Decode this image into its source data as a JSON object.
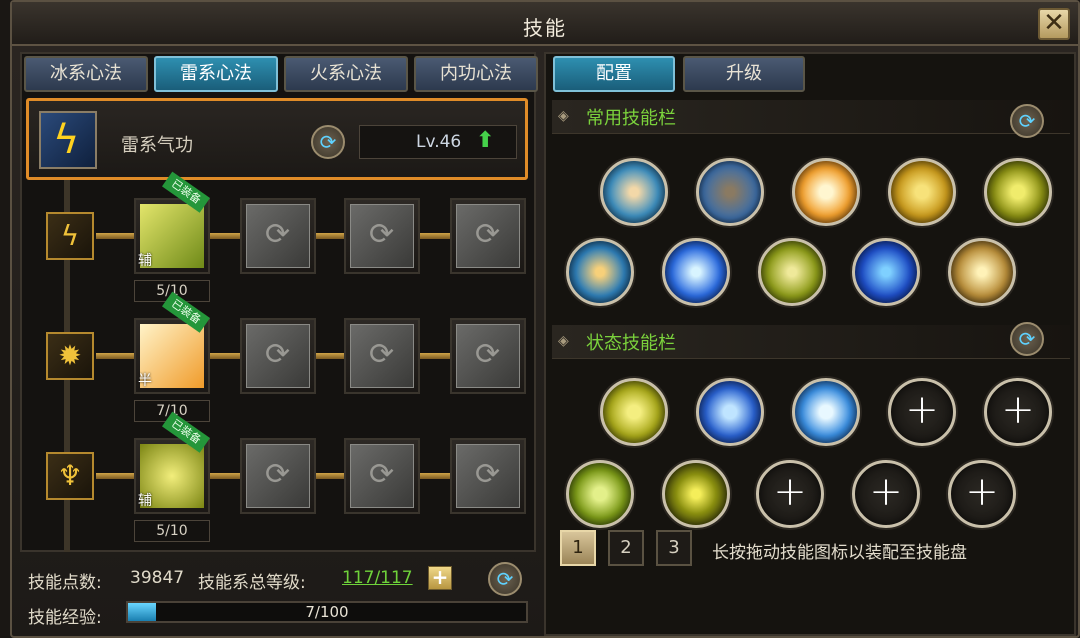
{
  "window": {
    "title": "技能",
    "close_icon": "close-icon"
  },
  "left_tabs": [
    {
      "label": "冰系心法",
      "active": false
    },
    {
      "label": "雷系心法",
      "active": true
    },
    {
      "label": "火系心法",
      "active": false
    },
    {
      "label": "内功心法",
      "active": false
    }
  ],
  "main_skill": {
    "name": "雷系气功",
    "level": "Lv.46",
    "icon": "lightning-icon",
    "upgrade_icon": "arrow-up-icon"
  },
  "skill_rows": [
    {
      "branch_icon": "lightning-icon",
      "equipped_badge": "已装备",
      "role_tag": "辅",
      "count": "5/10"
    },
    {
      "branch_icon": "burst-icon",
      "equipped_badge": "已装备",
      "role_tag": "半",
      "count": "7/10"
    },
    {
      "branch_icon": "figure-icon",
      "equipped_badge": "已装备",
      "role_tag": "辅",
      "count": "5/10"
    }
  ],
  "bottom": {
    "points_label": "技能点数:",
    "points_value": "39847",
    "total_level_label": "技能系总等级:",
    "total_level_value": "117/117",
    "exp_label": "技能经验:",
    "exp_text": "7/100",
    "exp_fraction": 0.07
  },
  "right_tabs": [
    {
      "label": "配置",
      "active": true
    },
    {
      "label": "升级",
      "active": false
    }
  ],
  "common_bar": {
    "title": "常用技能栏",
    "orbs": [
      "orb-blue-ray",
      "orb-warrior",
      "orb-fire-burst",
      "orb-golden-tiger",
      "orb-yellow-swirl",
      "orb-blue-swirl",
      "orb-ice-strike",
      "orb-lightning-blade",
      "orb-blue-crystal",
      "orb-gold-vortex"
    ]
  },
  "status_bar": {
    "title": "状态技能栏",
    "orbs": [
      "orb-yellow-beast",
      "orb-blue-wheel",
      "orb-ice-fan",
      "empty",
      "empty",
      "orb-green-figure",
      "orb-lightning-slash",
      "empty",
      "empty",
      "empty"
    ]
  },
  "pages": [
    "1",
    "2",
    "3"
  ],
  "hint": "长按拖动技能图标以装配至技能盘",
  "colors": {
    "accent_orange": "#e08c28",
    "active_tab": "#2e8fb0",
    "section_green": "#7bd23c"
  }
}
